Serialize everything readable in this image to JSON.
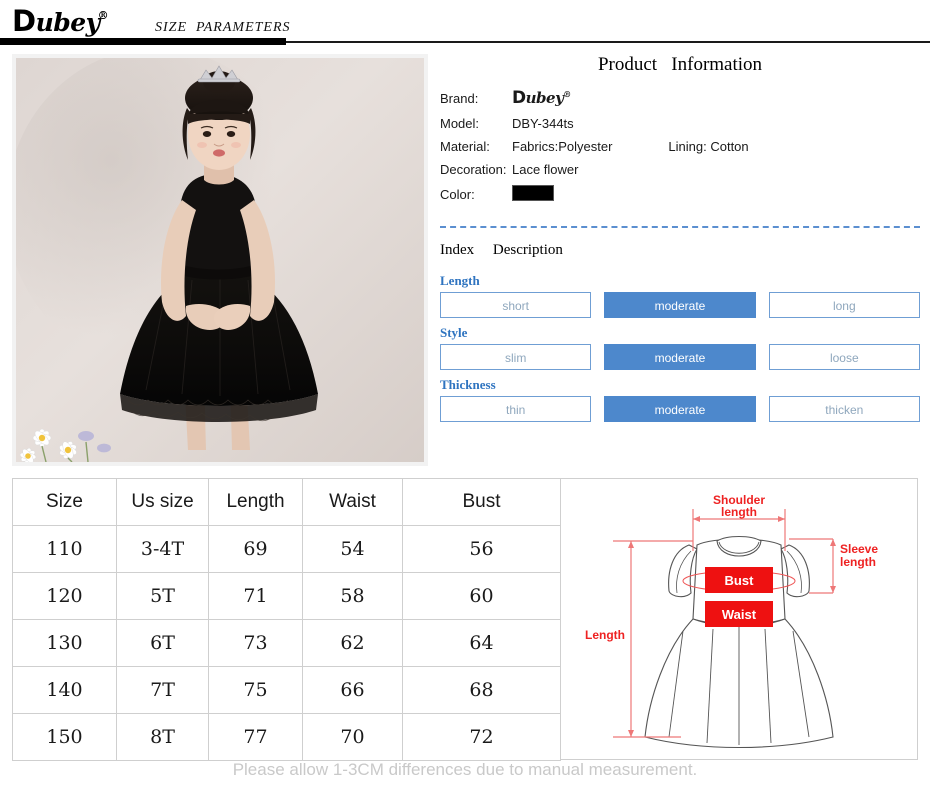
{
  "header": {
    "logo_text": "ubey",
    "logo_initial": "D",
    "logo_mark": "®",
    "title": "SIZE  PARAMETERS"
  },
  "photo": {
    "alt": "girl wearing black lace party dress standing against beige wall",
    "caption": ""
  },
  "product_info": {
    "title": "Product   Information",
    "rows": [
      {
        "label": "Brand:",
        "value": "",
        "is_brand_logo": true
      },
      {
        "label": "Model:",
        "value": "DBY-344ts"
      },
      {
        "label": "Material:",
        "value": "Fabrics:Polyester",
        "sub_value": "Lining: Cotton"
      },
      {
        "label": "Decoration:",
        "value": "Lace flower"
      },
      {
        "label": "Color:",
        "value": "",
        "is_swatch": true,
        "swatch_color": "#000000"
      }
    ]
  },
  "index_section": {
    "heading": "Index     Description",
    "groups": [
      {
        "label": "Length",
        "options": [
          {
            "text": "short",
            "selected": false
          },
          {
            "text": "moderate",
            "selected": true
          },
          {
            "text": "long",
            "selected": false
          }
        ]
      },
      {
        "label": "Style",
        "options": [
          {
            "text": "slim",
            "selected": false
          },
          {
            "text": "moderate",
            "selected": true
          },
          {
            "text": "loose",
            "selected": false
          }
        ]
      },
      {
        "label": "Thickness",
        "options": [
          {
            "text": "thin",
            "selected": false
          },
          {
            "text": "moderate",
            "selected": true
          },
          {
            "text": "thicken",
            "selected": false
          }
        ]
      }
    ]
  },
  "size_table": {
    "columns": [
      "Size",
      "Us size",
      "Length",
      "Waist",
      "Bust"
    ],
    "rows": [
      [
        "110",
        "3-4T",
        "69",
        "54",
        "56"
      ],
      [
        "120",
        "5T",
        "71",
        "58",
        "60"
      ],
      [
        "130",
        "6T",
        "73",
        "62",
        "64"
      ],
      [
        "140",
        "7T",
        "75",
        "66",
        "68"
      ],
      [
        "150",
        "8T",
        "77",
        "70",
        "72"
      ]
    ]
  },
  "diagram": {
    "labels": {
      "shoulder": "Shoulder",
      "shoulder2": "length",
      "sleeve": "Sleeve",
      "sleeve2": "length",
      "length": "Length",
      "bust": "Bust",
      "waist": "Waist"
    }
  },
  "footer": {
    "note": "Please allow 1-3CM differences due to manual measurement."
  },
  "colors": {
    "accent_blue": "#4d88cc",
    "label_blue": "#2f74c0",
    "diagram_red": "#ee1111",
    "border_gray": "#cfcfcf",
    "footer_gray": "#c9c9c9"
  }
}
